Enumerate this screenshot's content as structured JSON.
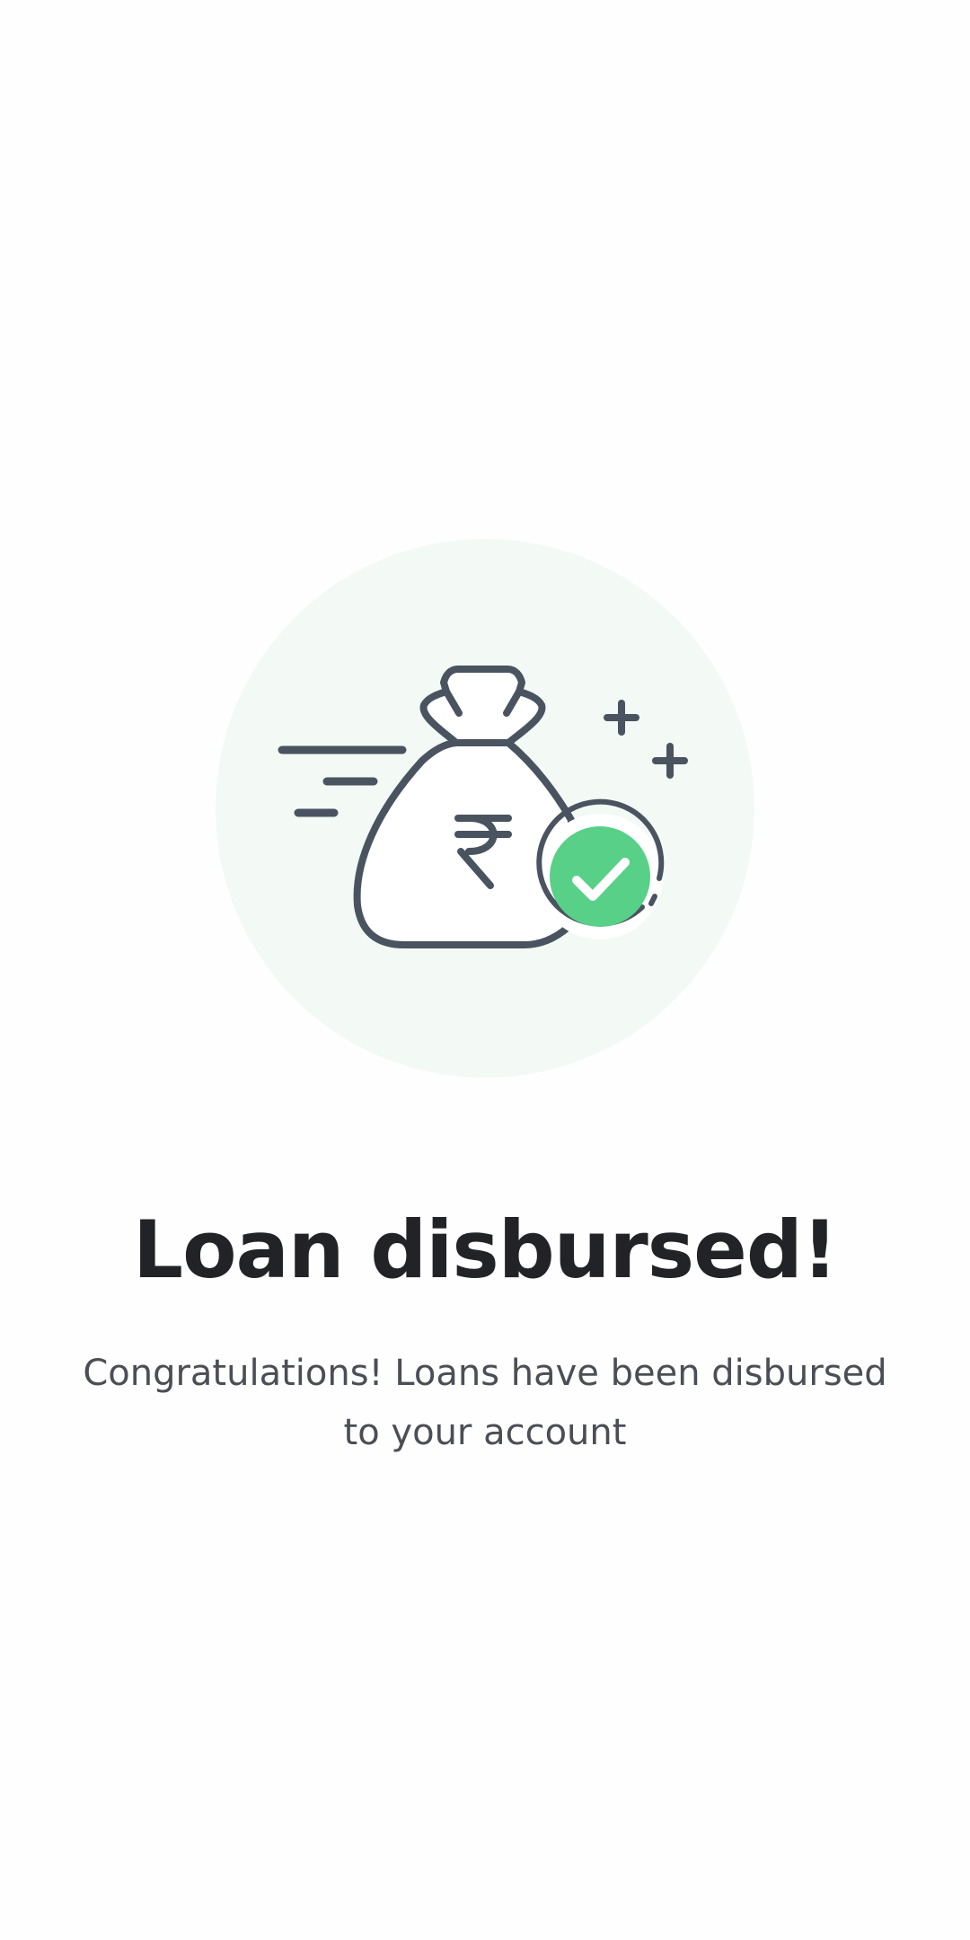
{
  "screen": {
    "title": "Loan disbursed!",
    "message": "Congratulations! Loans have been disbursed to your account",
    "illustration": {
      "icon": "money-bag-with-check-icon",
      "currency_symbol": "₹",
      "badge_icon": "check-icon"
    }
  },
  "colors": {
    "background": "#fefefe",
    "illustration_backdrop": "#f3faf5",
    "icon_stroke": "#4a5360",
    "success": "#58d088",
    "title": "#222326",
    "message": "#4b4e55"
  }
}
